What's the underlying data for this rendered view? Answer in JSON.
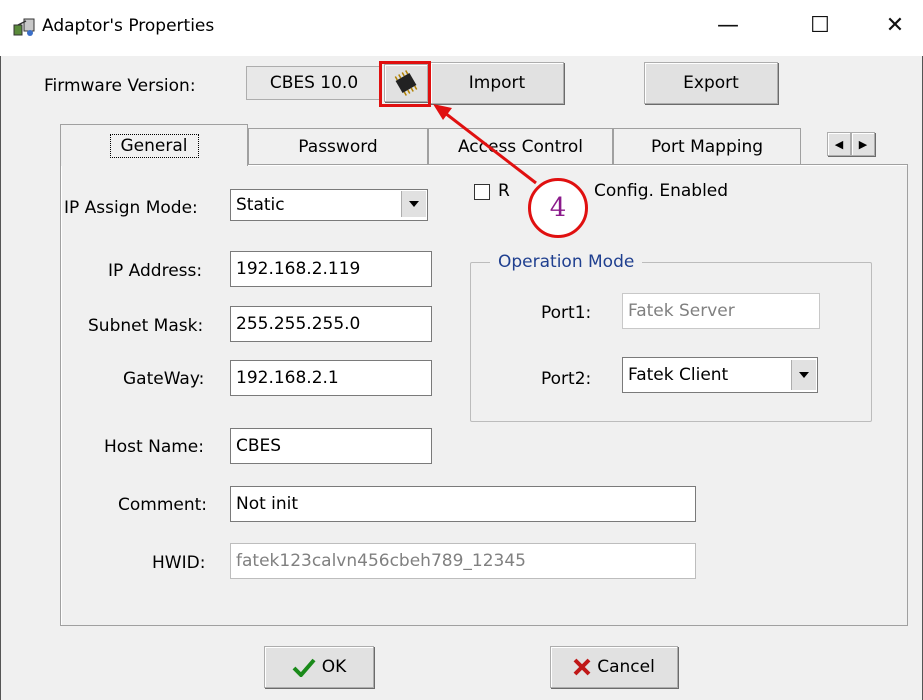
{
  "window": {
    "title": "Adaptor's Properties",
    "minimize": "—",
    "maximize": "☐",
    "close": "✕"
  },
  "firmware": {
    "label": "Firmware Version:",
    "value": "CBES 10.0",
    "import_label": "Import",
    "export_label": "Export"
  },
  "tabs": [
    {
      "label": "General"
    },
    {
      "label": "Password"
    },
    {
      "label": "Access Control"
    },
    {
      "label": "Port Mapping"
    }
  ],
  "tab_scroll": {
    "left": "◀",
    "right": "▶"
  },
  "general": {
    "ip_assign_mode": {
      "label": "IP Assign Mode:",
      "value": "Static"
    },
    "ip_address": {
      "label": "IP Address:",
      "value": "192.168.2.119"
    },
    "subnet_mask": {
      "label": "Subnet Mask:",
      "value": "255.255.255.0"
    },
    "gateway": {
      "label": "GateWay:",
      "value": "192.168.2.1"
    },
    "host_name": {
      "label": "Host Name:",
      "value": "CBES"
    },
    "comment": {
      "label": "Comment:",
      "value": "Not init"
    },
    "hwid": {
      "label": "HWID:",
      "value": "fatek123calvn456cbeh789_12345"
    },
    "remote_config": {
      "label_start": "R",
      "label_end": "Config. Enabled",
      "checked": false
    },
    "operation_mode": {
      "title": "Operation Mode",
      "port1": {
        "label": "Port1:",
        "value": "Fatek Server"
      },
      "port2": {
        "label": "Port2:",
        "value": "Fatek Client"
      }
    }
  },
  "buttons": {
    "ok_label": "OK",
    "cancel_label": "Cancel"
  },
  "annotation": {
    "step_number": "4",
    "color": "#e01010"
  },
  "icons": {
    "window": "network-adapter-icon",
    "chip": "chip-icon"
  }
}
